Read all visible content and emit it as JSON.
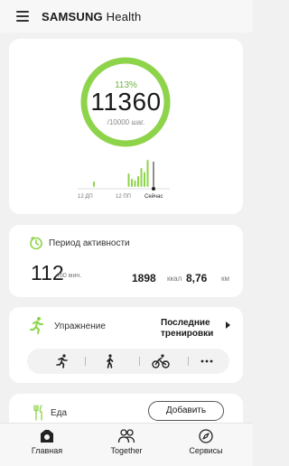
{
  "app": {
    "brand": "SAMSUNG",
    "name": "Health"
  },
  "colors": {
    "accent": "#8ed44a",
    "ring_track": "#e6e6e6",
    "bar": "#8ed44a"
  },
  "steps": {
    "percent": "113%",
    "count": "11360",
    "goal": "/10000 шаг.",
    "progress_fraction": 1.0,
    "chart_labels": {
      "start": "12 ДП",
      "mid": "12 ПП",
      "now": "Сейчас"
    },
    "hourly_bars": [
      {
        "hour": 2,
        "value": 0.2
      },
      {
        "hour": 13,
        "value": 0.5
      },
      {
        "hour": 14,
        "value": 0.3
      },
      {
        "hour": 15,
        "value": 0.25
      },
      {
        "hour": 16,
        "value": 0.4
      },
      {
        "hour": 17,
        "value": 0.7
      },
      {
        "hour": 18,
        "value": 0.55
      },
      {
        "hour": 19,
        "value": 1.0
      }
    ]
  },
  "activity": {
    "title": "Период активности",
    "minutes": "112",
    "minutes_unit": "/60 мин.",
    "kcal": "1898",
    "kcal_unit": "ккал",
    "distance": "8,76",
    "distance_unit": "км",
    "icon": "timer-icon"
  },
  "exercise": {
    "title": "Упражнение",
    "recent": "Последние тренировки",
    "buttons": [
      "running-icon",
      "walking-icon",
      "cycling-icon",
      "more-icon"
    ]
  },
  "food": {
    "title": "Еда",
    "add_label": "Добавить",
    "icon": "fork-knife-icon"
  },
  "nav": {
    "home": "Главная",
    "together": "Together",
    "services": "Сервисы"
  }
}
